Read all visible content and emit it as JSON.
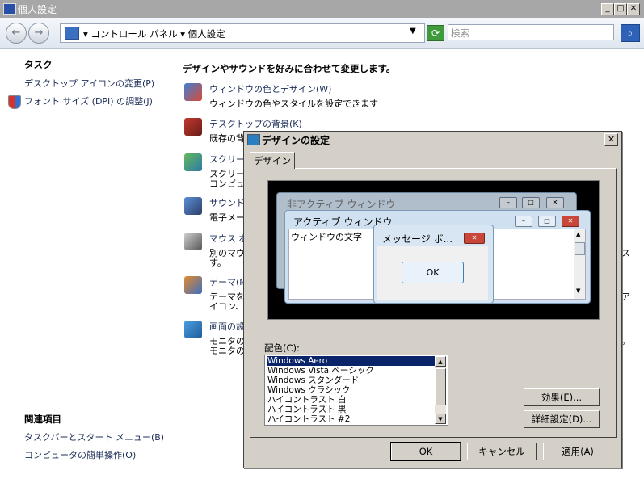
{
  "window": {
    "title": "個人設定"
  },
  "address": {
    "breadcrumb": "▾ コントロール パネル ▾ 個人設定",
    "search_placeholder": "検索"
  },
  "left_pane": {
    "tasks_heading": "タスク",
    "tasks": [
      "デスクトップ アイコンの変更(P)",
      "フォント サイズ (DPI) の調整(J)"
    ],
    "related_heading": "関連項目",
    "related": [
      "タスクバーとスタート メニュー(B)",
      "コンピュータの簡単操作(O)"
    ]
  },
  "main": {
    "heading": "デザインやサウンドを好みに合わせて変更します。",
    "items": [
      {
        "title": "ウィンドウの色とデザイン(W)",
        "desc": [
          "ウィンドウの色やスタイルを設定できます"
        ]
      },
      {
        "title": "デスクトップの背景(K)",
        "desc": [
          "既存の背"
        ]
      },
      {
        "title": "スクリーン",
        "desc": [
          "スクリーン",
          "コンピュ"
        ]
      },
      {
        "title": "サウンド(",
        "desc": [
          "電子メー"
        ]
      },
      {
        "title": "マウス ポ",
        "desc": [
          "別のマウ",
          "す。"
        ]
      },
      {
        "title": "テーマ(M",
        "desc": [
          "テーマを",
          "イコン、"
        ]
      },
      {
        "title": "画面の設",
        "desc": [
          "モニタの解",
          "モニタの"
        ]
      }
    ],
    "right_overflow": [
      "ス",
      "ア",
      "。"
    ]
  },
  "dialog": {
    "title": "デザインの設定",
    "tab": "デザイン",
    "preview": {
      "inactive_title": "非アクティブ ウィンドウ",
      "active_title": "アクティブ ウィンドウ",
      "window_text": "ウィンドウの文字",
      "message_title": "メッセージ ボ...",
      "ok": "OK"
    },
    "color_scheme_label": "配色(C):",
    "color_schemes": [
      "Windows Aero",
      "Windows Vista ベーシック",
      "Windows スタンダード",
      "Windows クラシック",
      "ハイコントラスト 白",
      "ハイコントラスト 黒",
      "ハイコントラスト #2"
    ],
    "selected_scheme": "Windows Aero",
    "effects_button": "効果(E)...",
    "advanced_button": "詳細設定(D)...",
    "ok_button": "OK",
    "cancel_button": "キャンセル",
    "apply_button": "適用(A)"
  }
}
